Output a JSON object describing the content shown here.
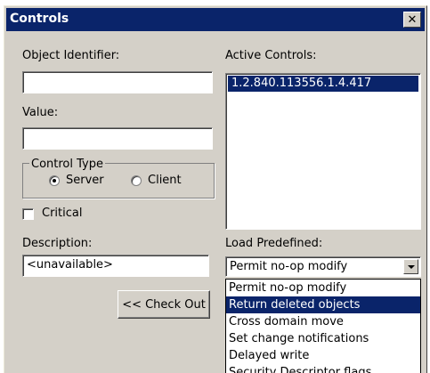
{
  "window": {
    "title": "Controls"
  },
  "labels": {
    "object_identifier": "Object Identifier:",
    "value": "Value:",
    "control_type": "Control Type",
    "description": "Description:",
    "active_controls": "Active Controls:",
    "load_predefined": "Load Predefined:"
  },
  "fields": {
    "object_identifier": "",
    "value": "",
    "description": "<unavailable>"
  },
  "control_type": {
    "server_label": "Server",
    "client_label": "Client",
    "selected": "Server"
  },
  "critical": {
    "label": "Critical",
    "checked": false
  },
  "buttons": {
    "check_out": "<< Check Out"
  },
  "active_controls": [
    "1.2.840.113556.1.4.417"
  ],
  "load_predefined": {
    "selected": "Permit no-op modify",
    "options": [
      "Permit no-op modify",
      "Return deleted objects",
      "Cross domain move",
      "Set change notifications",
      "Delayed write",
      "Security Descriptor flags"
    ],
    "highlighted": "Return deleted objects"
  },
  "icons": {
    "close": "close-icon",
    "dropdown_arrow": "chevron-down-icon"
  },
  "colors": {
    "title_bar": "#0a246a",
    "dialog_bg": "#d4d0c8",
    "selection": "#0a246a"
  }
}
